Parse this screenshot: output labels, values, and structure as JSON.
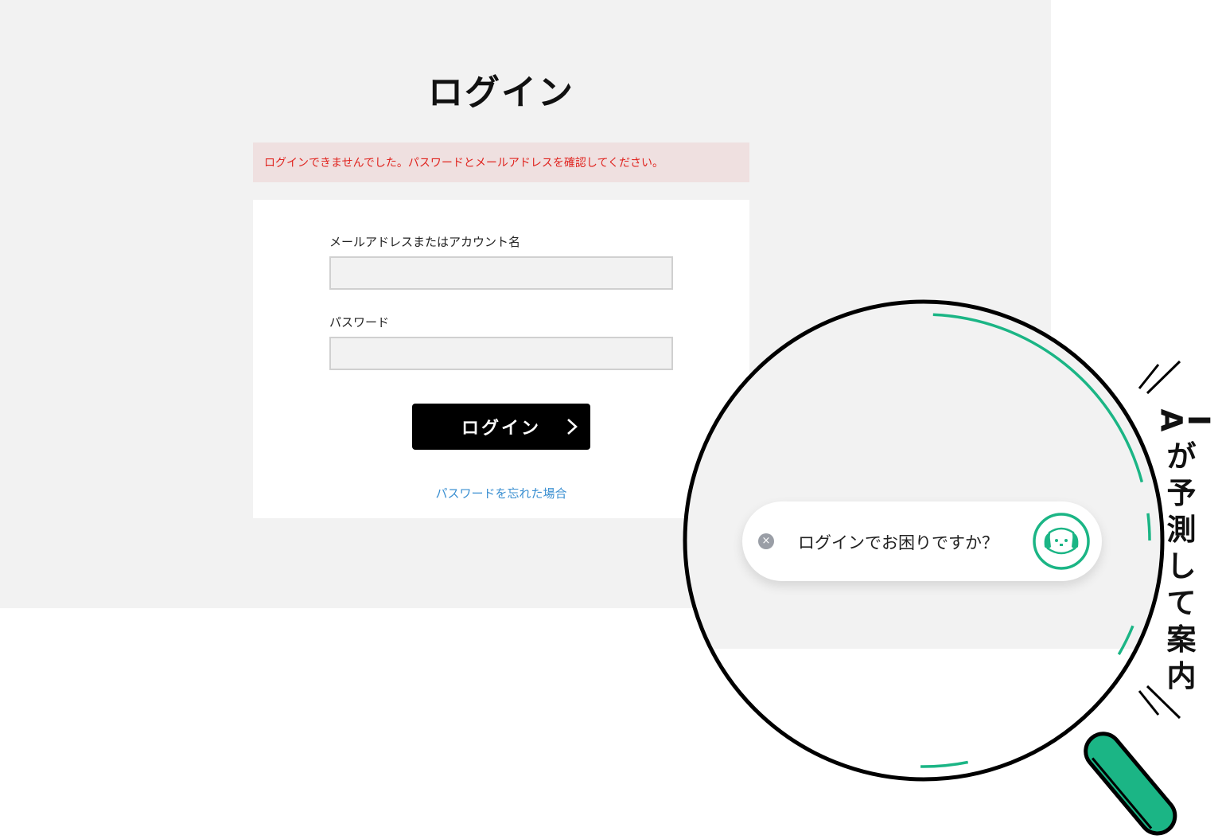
{
  "page": {
    "title": "ログイン",
    "error_message": "ログインできませんでした。パスワードとメールアドレスを確認してください。"
  },
  "form": {
    "email_label": "メールアドレスまたはアカウント名",
    "email_value": "",
    "password_label": "パスワード",
    "password_value": "",
    "submit_label": "ログイン",
    "forgot_link": "パスワードを忘れた場合"
  },
  "assistant": {
    "prompt": "ログインでお困りですか？",
    "close_symbol": "×",
    "caption_chars": [
      "A",
      "I",
      "が",
      "予",
      "測",
      "し",
      "て",
      "案",
      "内"
    ]
  },
  "colors": {
    "page_bg": "#f2f2f2",
    "error_bg": "#efe0e0",
    "error_text": "#e0241f",
    "button_bg": "#000000",
    "link": "#3a8fd1",
    "accent_green": "#1bb585"
  },
  "icons": {
    "button_chevron": "chevron-right-icon",
    "close": "close-icon",
    "bot": "dog-bot-icon",
    "magnifier": "magnifying-glass-icon"
  }
}
